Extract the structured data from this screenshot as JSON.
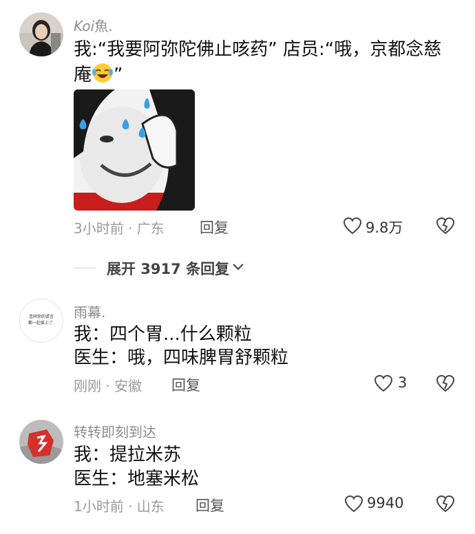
{
  "comments": [
    {
      "username": "Koi",
      "username_suffix": "魚.",
      "line1": "我:“我要阿弥陀佛止咳药” 店员:“哦，京都念慈",
      "line2_pre": "庵",
      "line2_post": "”",
      "meta": "3小时前 · 广东",
      "reply_label": "回复",
      "likes": "9.8万"
    },
    {
      "username": "雨幕.",
      "avatar_text_1": "连同你的谎言",
      "avatar_text_2": "都一起爱上了.",
      "line1": "我：四个胃...什么颗粒",
      "line2": "医生：哦，四味脾胃舒颗粒",
      "meta": "刚刚 · 安徽",
      "reply_label": "回复",
      "likes": "3"
    },
    {
      "username": "转转即刻到达",
      "line1": "我：提拉米苏",
      "line2": "医生：地塞米松",
      "meta": "1小时前 · 山东",
      "reply_label": "回复",
      "likes": "9940"
    }
  ],
  "expand": {
    "label": "展开 3917 条回复"
  },
  "icons": {
    "like": "heart-outline-icon",
    "dislike": "broken-heart-icon",
    "expand": "chevron-down-icon",
    "emoji": "laughing-crying-emoji-icon"
  },
  "colors": {
    "text": "#111111",
    "muted": "#9a9a9a",
    "username": "#8c8c8c"
  }
}
